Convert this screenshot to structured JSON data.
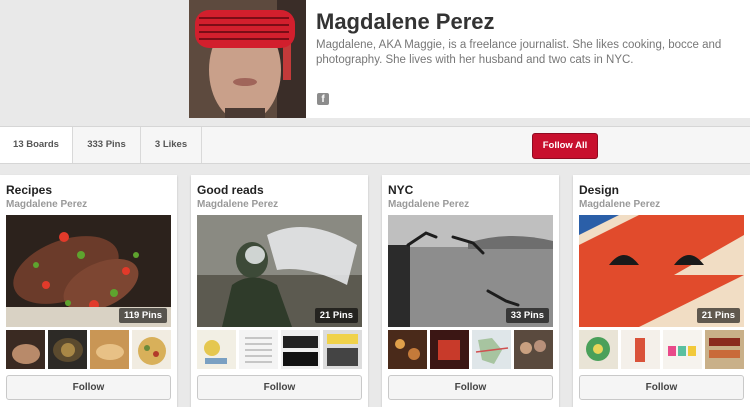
{
  "profile": {
    "name": "Magdalene Perez",
    "bio": "Magdalene, AKA Maggie, is a freelance journalist. She likes cooking, bocce and photography. She lives with her husband and two cats in NYC.",
    "facebook_icon": "facebook-icon"
  },
  "stats": {
    "boards": "13 Boards",
    "pins": "333 Pins",
    "likes": "3 Likes"
  },
  "follow_all_label": "Follow All",
  "colors": {
    "accent": "#c8102e",
    "background": "#e9e9e9"
  },
  "boards": [
    {
      "title": "Recipes",
      "owner": "Magdalene Perez",
      "pins": "119 Pins",
      "follow": "Follow"
    },
    {
      "title": "Good reads",
      "owner": "Magdalene Perez",
      "pins": "21 Pins",
      "follow": "Follow"
    },
    {
      "title": "NYC",
      "owner": "Magdalene Perez",
      "pins": "33 Pins",
      "follow": "Follow"
    },
    {
      "title": "Design",
      "owner": "Magdalene Perez",
      "pins": "21 Pins",
      "follow": "Follow"
    }
  ]
}
